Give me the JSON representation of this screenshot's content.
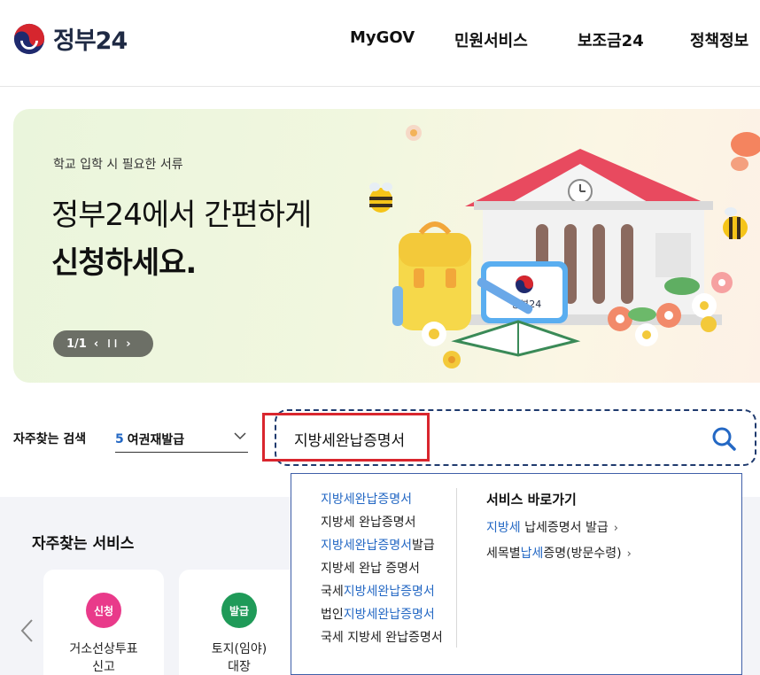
{
  "header": {
    "logo_text": "정부24",
    "nav": [
      "MyGOV",
      "민원서비스",
      "보조금24",
      "정책정보"
    ]
  },
  "banner": {
    "subtitle": "학교 입학 시 필요한 서류",
    "title_line1": "정부24에서 간편하게",
    "title_line2": "신청하세요.",
    "pager": "1/1",
    "prev_icon": "‹",
    "pause_icon": "❙❙",
    "next_icon": "›",
    "art_sign_text": "정부24"
  },
  "search": {
    "freq_label": "자주찾는 검색",
    "freq_rank": "5",
    "freq_term": "여권재발급",
    "query": "지방세완납증명서",
    "icon": "search-icon"
  },
  "services": {
    "title": "자주찾는 서비스",
    "cards": [
      {
        "badge": "신청",
        "badge_color": "#e93a8a",
        "name": "거소선상투표",
        "name2": "신고"
      },
      {
        "badge": "발급",
        "badge_color": "#1f9a58",
        "name": "토지(임야)",
        "name2": "대장"
      }
    ]
  },
  "autocomplete": {
    "suggestions": [
      {
        "pre": "",
        "hl": "지방세완납증명서",
        "post": ""
      },
      {
        "pre": "지방세 완납증명서",
        "hl": "",
        "post": ""
      },
      {
        "pre": "",
        "hl": "지방세완납증명서",
        "post": "발급"
      },
      {
        "pre": "지방세 완납 증명서",
        "hl": "",
        "post": ""
      },
      {
        "pre": "국세",
        "hl": "지방세완납증명서",
        "post": ""
      },
      {
        "pre": "법인",
        "hl": "지방세완납증명서",
        "post": ""
      },
      {
        "pre": "국세 지방세 완납증명서",
        "hl": "",
        "post": ""
      }
    ],
    "shortcut_title": "서비스 바로가기",
    "shortcuts": [
      {
        "pre": "",
        "hl": "지방세",
        "post": " 납세증명서 발급"
      },
      {
        "pre": "세목별",
        "hl": "납세",
        "post": "증명(방문수령)"
      }
    ],
    "chevron": "›"
  },
  "colors": {
    "accent_blue": "#2468c4",
    "highlight_red": "#d9262e",
    "search_border": "#1f3a6e"
  }
}
